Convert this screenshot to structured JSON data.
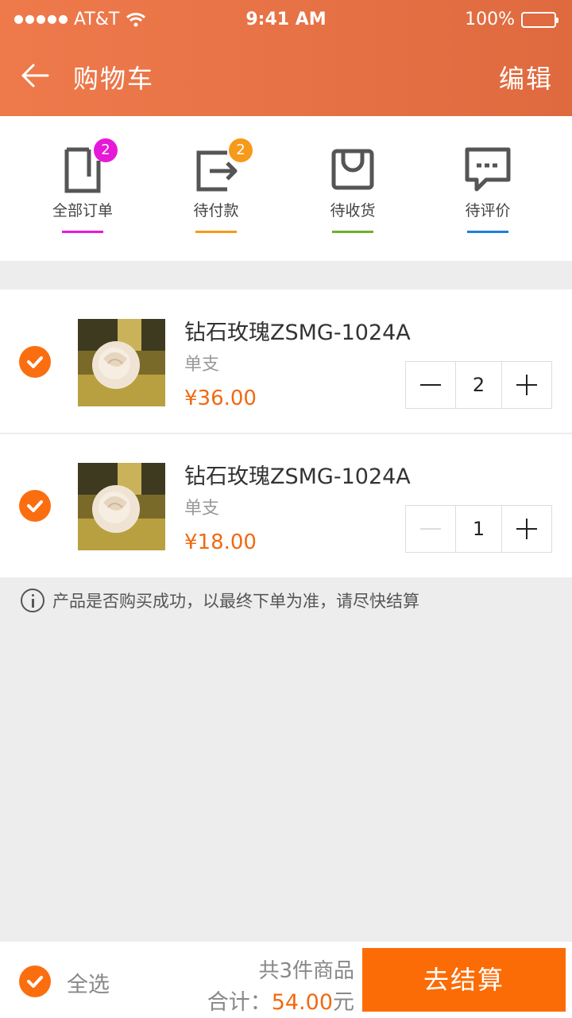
{
  "status_bar": {
    "carrier": "AT&T",
    "time": "9:41 AM",
    "battery": "100%"
  },
  "nav": {
    "title": "购物车",
    "edit_label": "编辑"
  },
  "order_tabs": [
    {
      "label": "全部订单",
      "badge": "2",
      "icon": "order-list-icon",
      "color": "#e619d8"
    },
    {
      "label": "待付款",
      "badge": "2",
      "icon": "payment-pending-icon",
      "color": "#f59a1a"
    },
    {
      "label": "待收货",
      "badge": "",
      "icon": "shopping-bag-icon",
      "color": "#6cb12d"
    },
    {
      "label": "待评价",
      "badge": "",
      "icon": "comment-icon",
      "color": "#1e7fd8"
    }
  ],
  "cart_items": [
    {
      "name": "钻石玫瑰ZSMG-1024A",
      "spec": "单支",
      "price": "¥36.00",
      "quantity": "2"
    },
    {
      "name": "钻石玫瑰ZSMG-1024A",
      "spec": "单支",
      "price": "¥18.00",
      "quantity": "1"
    }
  ],
  "notice": "产品是否购买成功，以最终下单为准，请尽快结算",
  "footer": {
    "select_all": "全选",
    "count_text": "共3件商品",
    "total_label": "合计：",
    "total_amount": "54.00",
    "total_unit": "元",
    "checkout_label": "去结算"
  },
  "colors": {
    "accent": "#fb6e10",
    "header": "#e8734a",
    "price": "#f06a12"
  }
}
